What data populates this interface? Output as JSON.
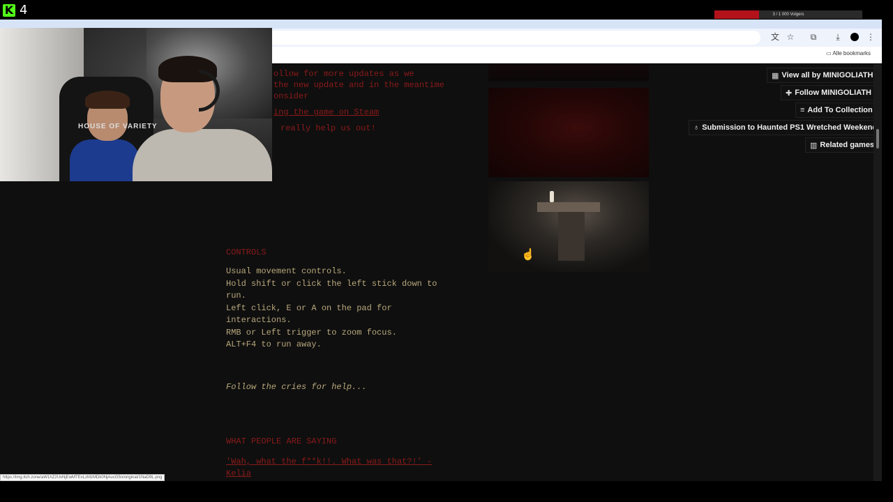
{
  "stream_overlay": {
    "logo_icon": "kick-logo-icon",
    "logo_letter": "K",
    "viewer_count": "4",
    "goal_text": "3 / 1 000",
    "goal_sub": "Volgers",
    "goal_progress": 0.3,
    "goal_color": "#b3121b"
  },
  "browser": {
    "toolbar_icons": [
      "translate-icon",
      "star-icon",
      "extensions-icon",
      "download-icon",
      "profile-icon",
      "menu-icon"
    ],
    "bookmarks_folder": "Alle bookmarks"
  },
  "description": {
    "line1": "ollow for more updates as we",
    "line2": "the new update and in the meantime",
    "line3": "onsider",
    "steam_link": "ing the game on Steam",
    "line5": "really help us out!",
    "controls_heading": "CONTROLS",
    "controls": [
      "Usual movement controls.",
      "Hold shift or click the left stick down to",
      "run.",
      "Left click, E or A on the pad for",
      "interactions.",
      "RMB or Left trigger to zoom focus.",
      "ALT+F4 to run away."
    ],
    "tagline": "Follow the cries for help...",
    "reviews_heading": "WHAT PEOPLE ARE SAYING",
    "review_quote": "'Wah, what the f**k!!. What was that?!' -",
    "review_author": "Kelia"
  },
  "sidebar_buttons": [
    {
      "icon": "itch-icon",
      "glyph": "▦",
      "label": "View all by MINIGOLIATH"
    },
    {
      "icon": "follow-icon",
      "glyph": "✚",
      "label": "Follow MINIGOLIATH"
    },
    {
      "icon": "collection-icon",
      "glyph": "≡",
      "label": "Add To Collection"
    },
    {
      "icon": "award-icon",
      "glyph": "♁",
      "label": "Submission to Haunted PS1 Wretched Weekend 1"
    },
    {
      "icon": "map-icon",
      "glyph": "▥",
      "label": "Related games"
    }
  ],
  "webcam": {
    "chair_text": "HOUSE OF VARIETY"
  },
  "status_url": "https://img.itch.zone/aW1hZ2UvNjEwMTExLzMzMDk0NjAucG5n/original/1NaD9L.png"
}
